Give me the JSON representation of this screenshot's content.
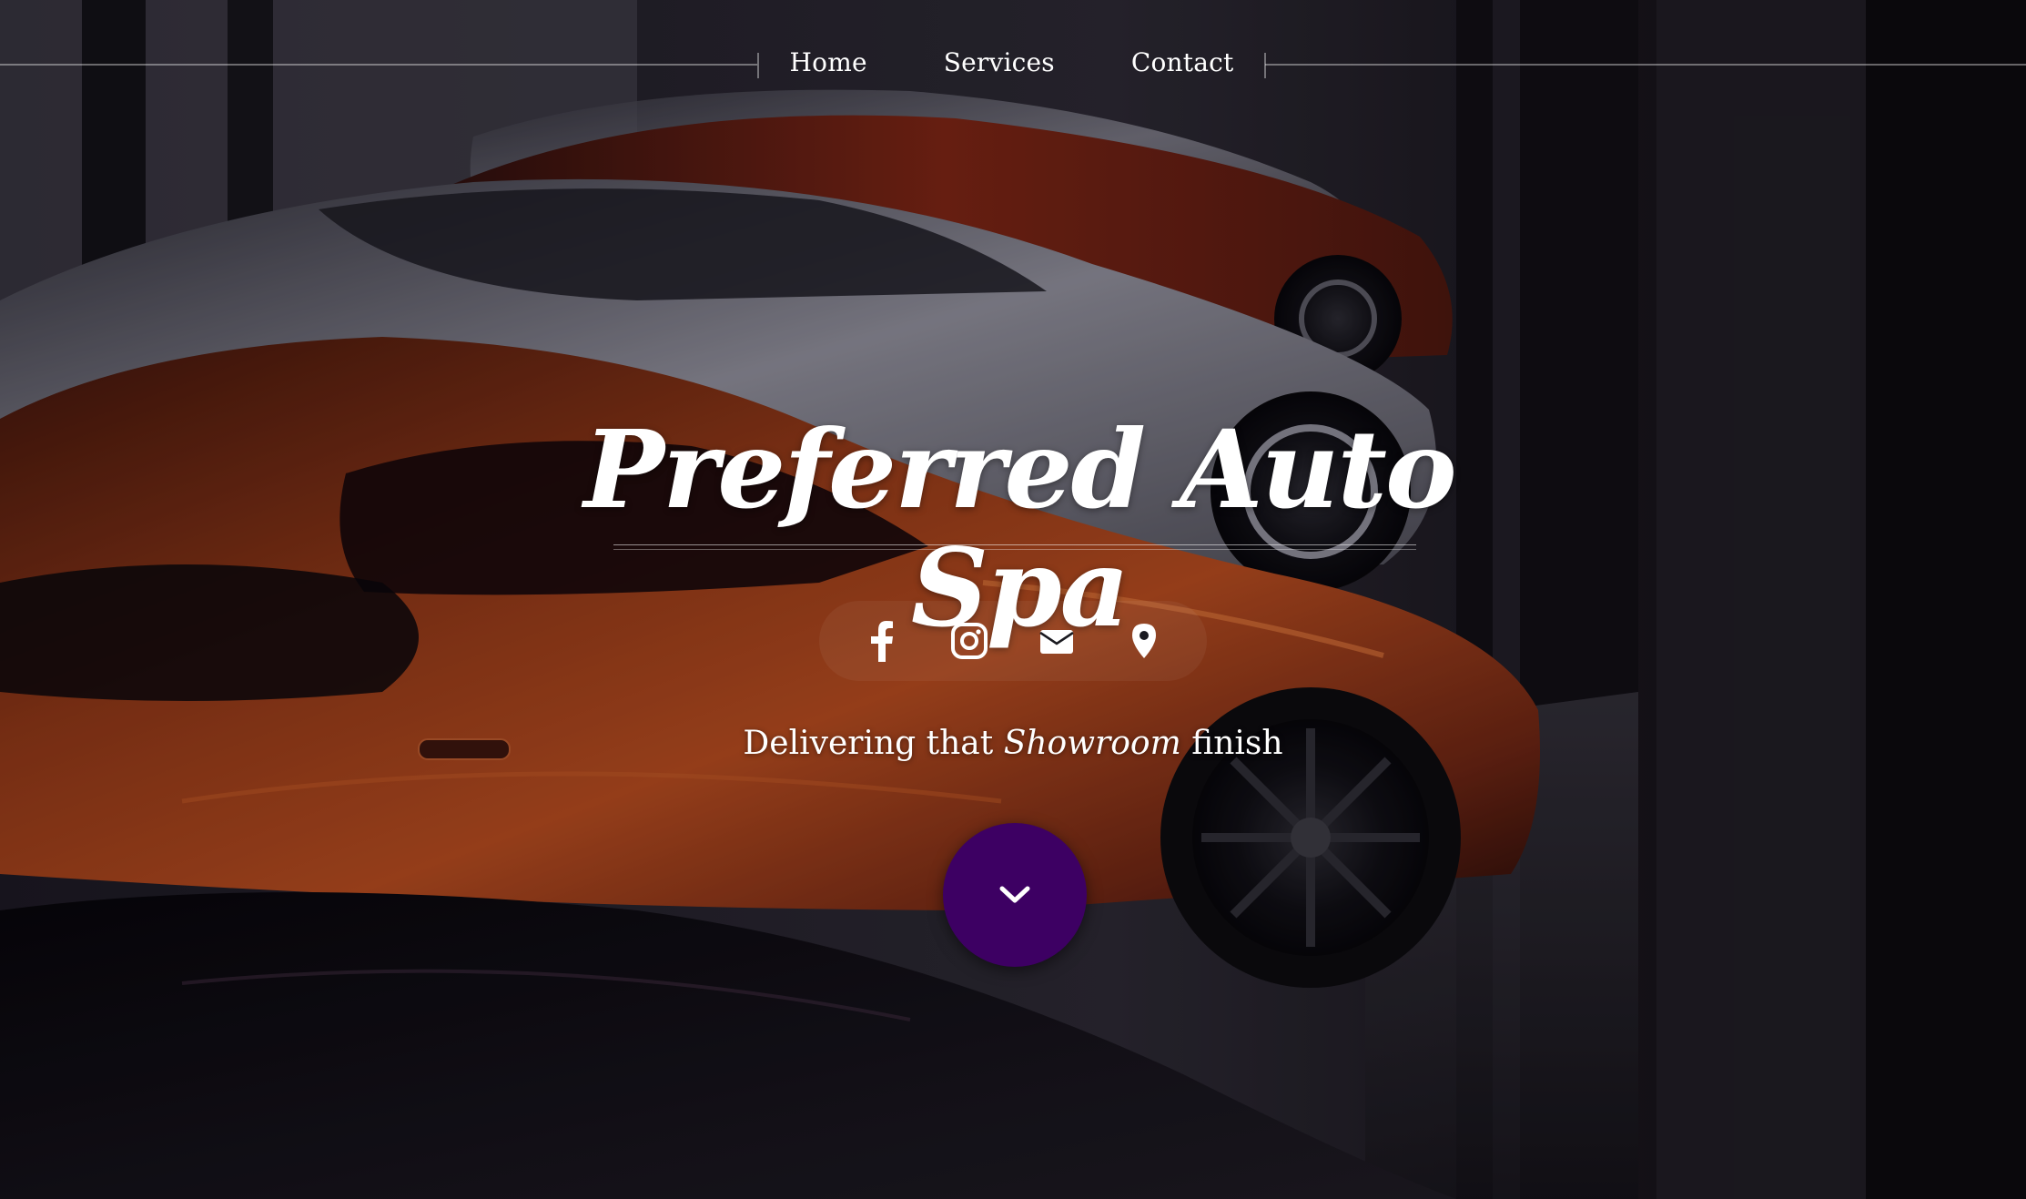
{
  "nav": {
    "items": [
      {
        "label": "Home"
      },
      {
        "label": "Services"
      },
      {
        "label": "Contact"
      }
    ]
  },
  "hero": {
    "title": "Preferred Auto Spa",
    "tagline_before": "Delivering that",
    "tagline_emphasis": "Showroom",
    "tagline_after": "finish"
  },
  "social": {
    "icons": [
      "facebook-icon",
      "instagram-icon",
      "envelope-icon",
      "map-marker-icon"
    ]
  },
  "scroll": {
    "icon": "chevron-down-icon"
  },
  "colors": {
    "accent": "#3d0063",
    "text": "#ffffff",
    "car_orange": "#8a3414"
  }
}
